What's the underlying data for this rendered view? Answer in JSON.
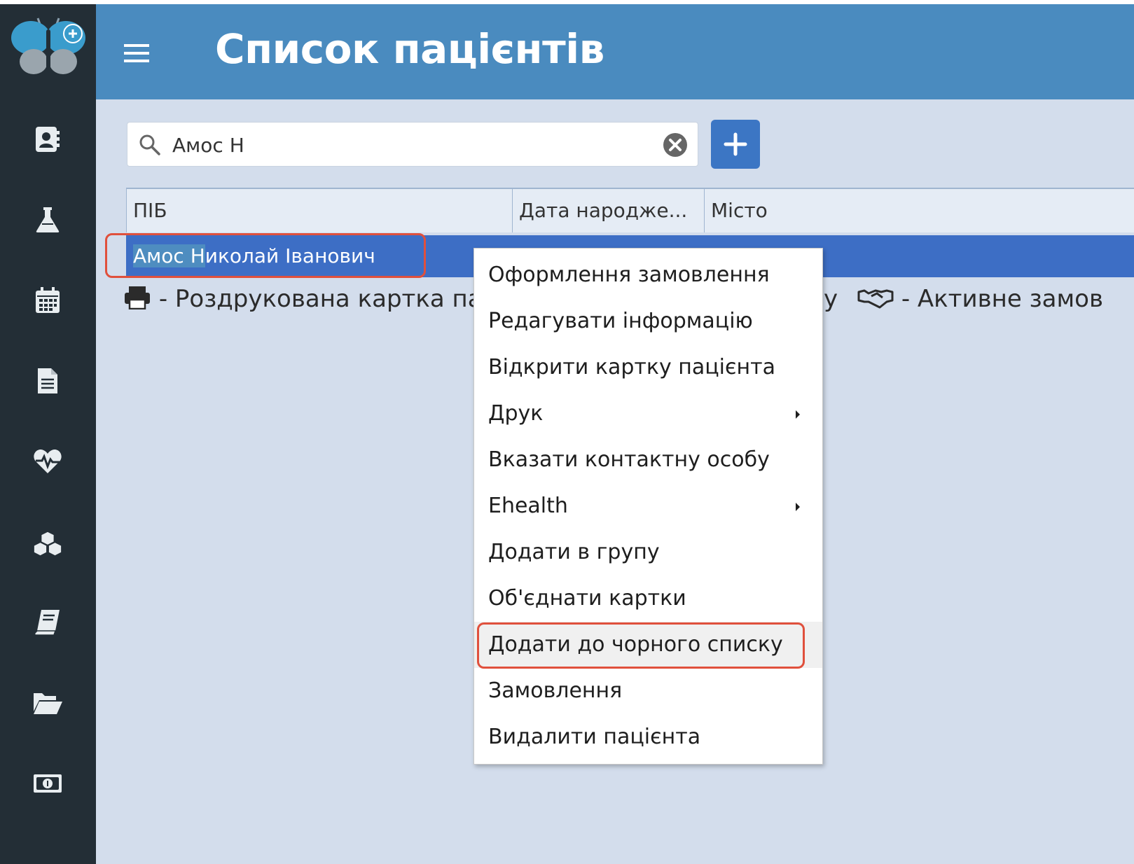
{
  "app": {
    "title": "Список пацієнтів",
    "accent_color": "#4a8bbf",
    "sidebar_color": "#232e36"
  },
  "sidebar": {
    "logo": "butterfly-logo-with-plus",
    "items": [
      {
        "icon": "contact-card-icon"
      },
      {
        "icon": "flask-icon"
      },
      {
        "icon": "calendar-icon"
      },
      {
        "icon": "document-icon"
      },
      {
        "icon": "heartbeat-icon"
      },
      {
        "icon": "cubes-icon"
      },
      {
        "icon": "book-icon"
      },
      {
        "icon": "folder-open-icon"
      },
      {
        "icon": "money-icon"
      }
    ]
  },
  "search": {
    "value": "Амос Н"
  },
  "table": {
    "columns": [
      "ПІБ",
      "Дата народже...",
      "Місто"
    ],
    "rows": [
      {
        "name_highlight": "Амос Н",
        "name_rest": "иколай Іванович",
        "selected": true
      }
    ]
  },
  "legend": {
    "printed_card": "- Роздрукована картка па",
    "middle_fragment": "у",
    "active_order": "- Активне замов"
  },
  "context_menu": {
    "items": [
      {
        "label": "Оформлення замовлення",
        "submenu": false
      },
      {
        "label": "Редагувати інформацію",
        "submenu": false
      },
      {
        "label": "Відкрити картку пацієнта",
        "submenu": false
      },
      {
        "label": "Друк",
        "submenu": true
      },
      {
        "label": "Вказати контактну особу",
        "submenu": false
      },
      {
        "label": "Ehealth",
        "submenu": true
      },
      {
        "label": "Додати в групу",
        "submenu": false
      },
      {
        "label": "Об'єднати картки",
        "submenu": false
      },
      {
        "label": "Додати до чорного списку",
        "submenu": false,
        "hovered": true
      },
      {
        "label": "Замовлення",
        "submenu": false
      },
      {
        "label": "Видалити пацієнта",
        "submenu": false
      }
    ]
  },
  "annotation_color": "#e0503c"
}
